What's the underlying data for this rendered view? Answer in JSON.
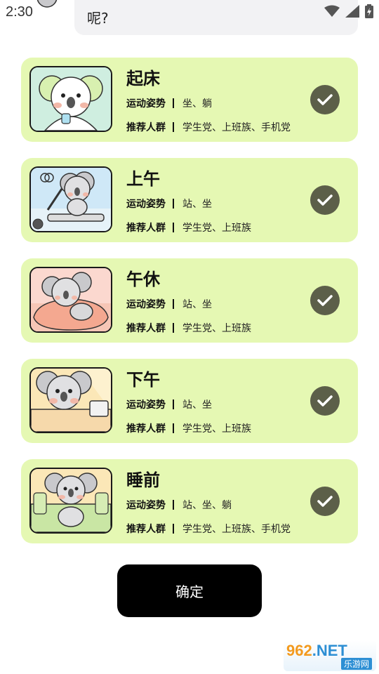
{
  "status_bar": {
    "time": "2:30"
  },
  "question": {
    "text": "呢?"
  },
  "cards": [
    {
      "title": "起床",
      "posture_label": "运动姿势",
      "posture": "坐、躺",
      "audience_label": "推荐人群",
      "audience": "学生党、上班族、手机党",
      "selected": true
    },
    {
      "title": "上午",
      "posture_label": "运动姿势",
      "posture": "站、坐",
      "audience_label": "推荐人群",
      "audience": "学生党、上班族",
      "selected": true
    },
    {
      "title": "午休",
      "posture_label": "运动姿势",
      "posture": "站、坐",
      "audience_label": "推荐人群",
      "audience": "学生党、上班族",
      "selected": true
    },
    {
      "title": "下午",
      "posture_label": "运动姿势",
      "posture": "站、坐",
      "audience_label": "推荐人群",
      "audience": "学生党、上班族",
      "selected": true
    },
    {
      "title": "睡前",
      "posture_label": "运动姿势",
      "posture": "站、坐、躺",
      "audience_label": "推荐人群",
      "audience": "学生党、上班族、手机党",
      "selected": true
    }
  ],
  "confirm_label": "确定",
  "watermark": {
    "main": "962",
    "net": ".NET",
    "sub": "乐游网"
  },
  "colors": {
    "card_bg": "#e5f8b3",
    "check_bg": "#5c5f49",
    "button_bg": "#000000"
  },
  "icons": [
    "wifi-icon",
    "cellular-signal-icon",
    "battery-icon",
    "checkmark-icon"
  ]
}
